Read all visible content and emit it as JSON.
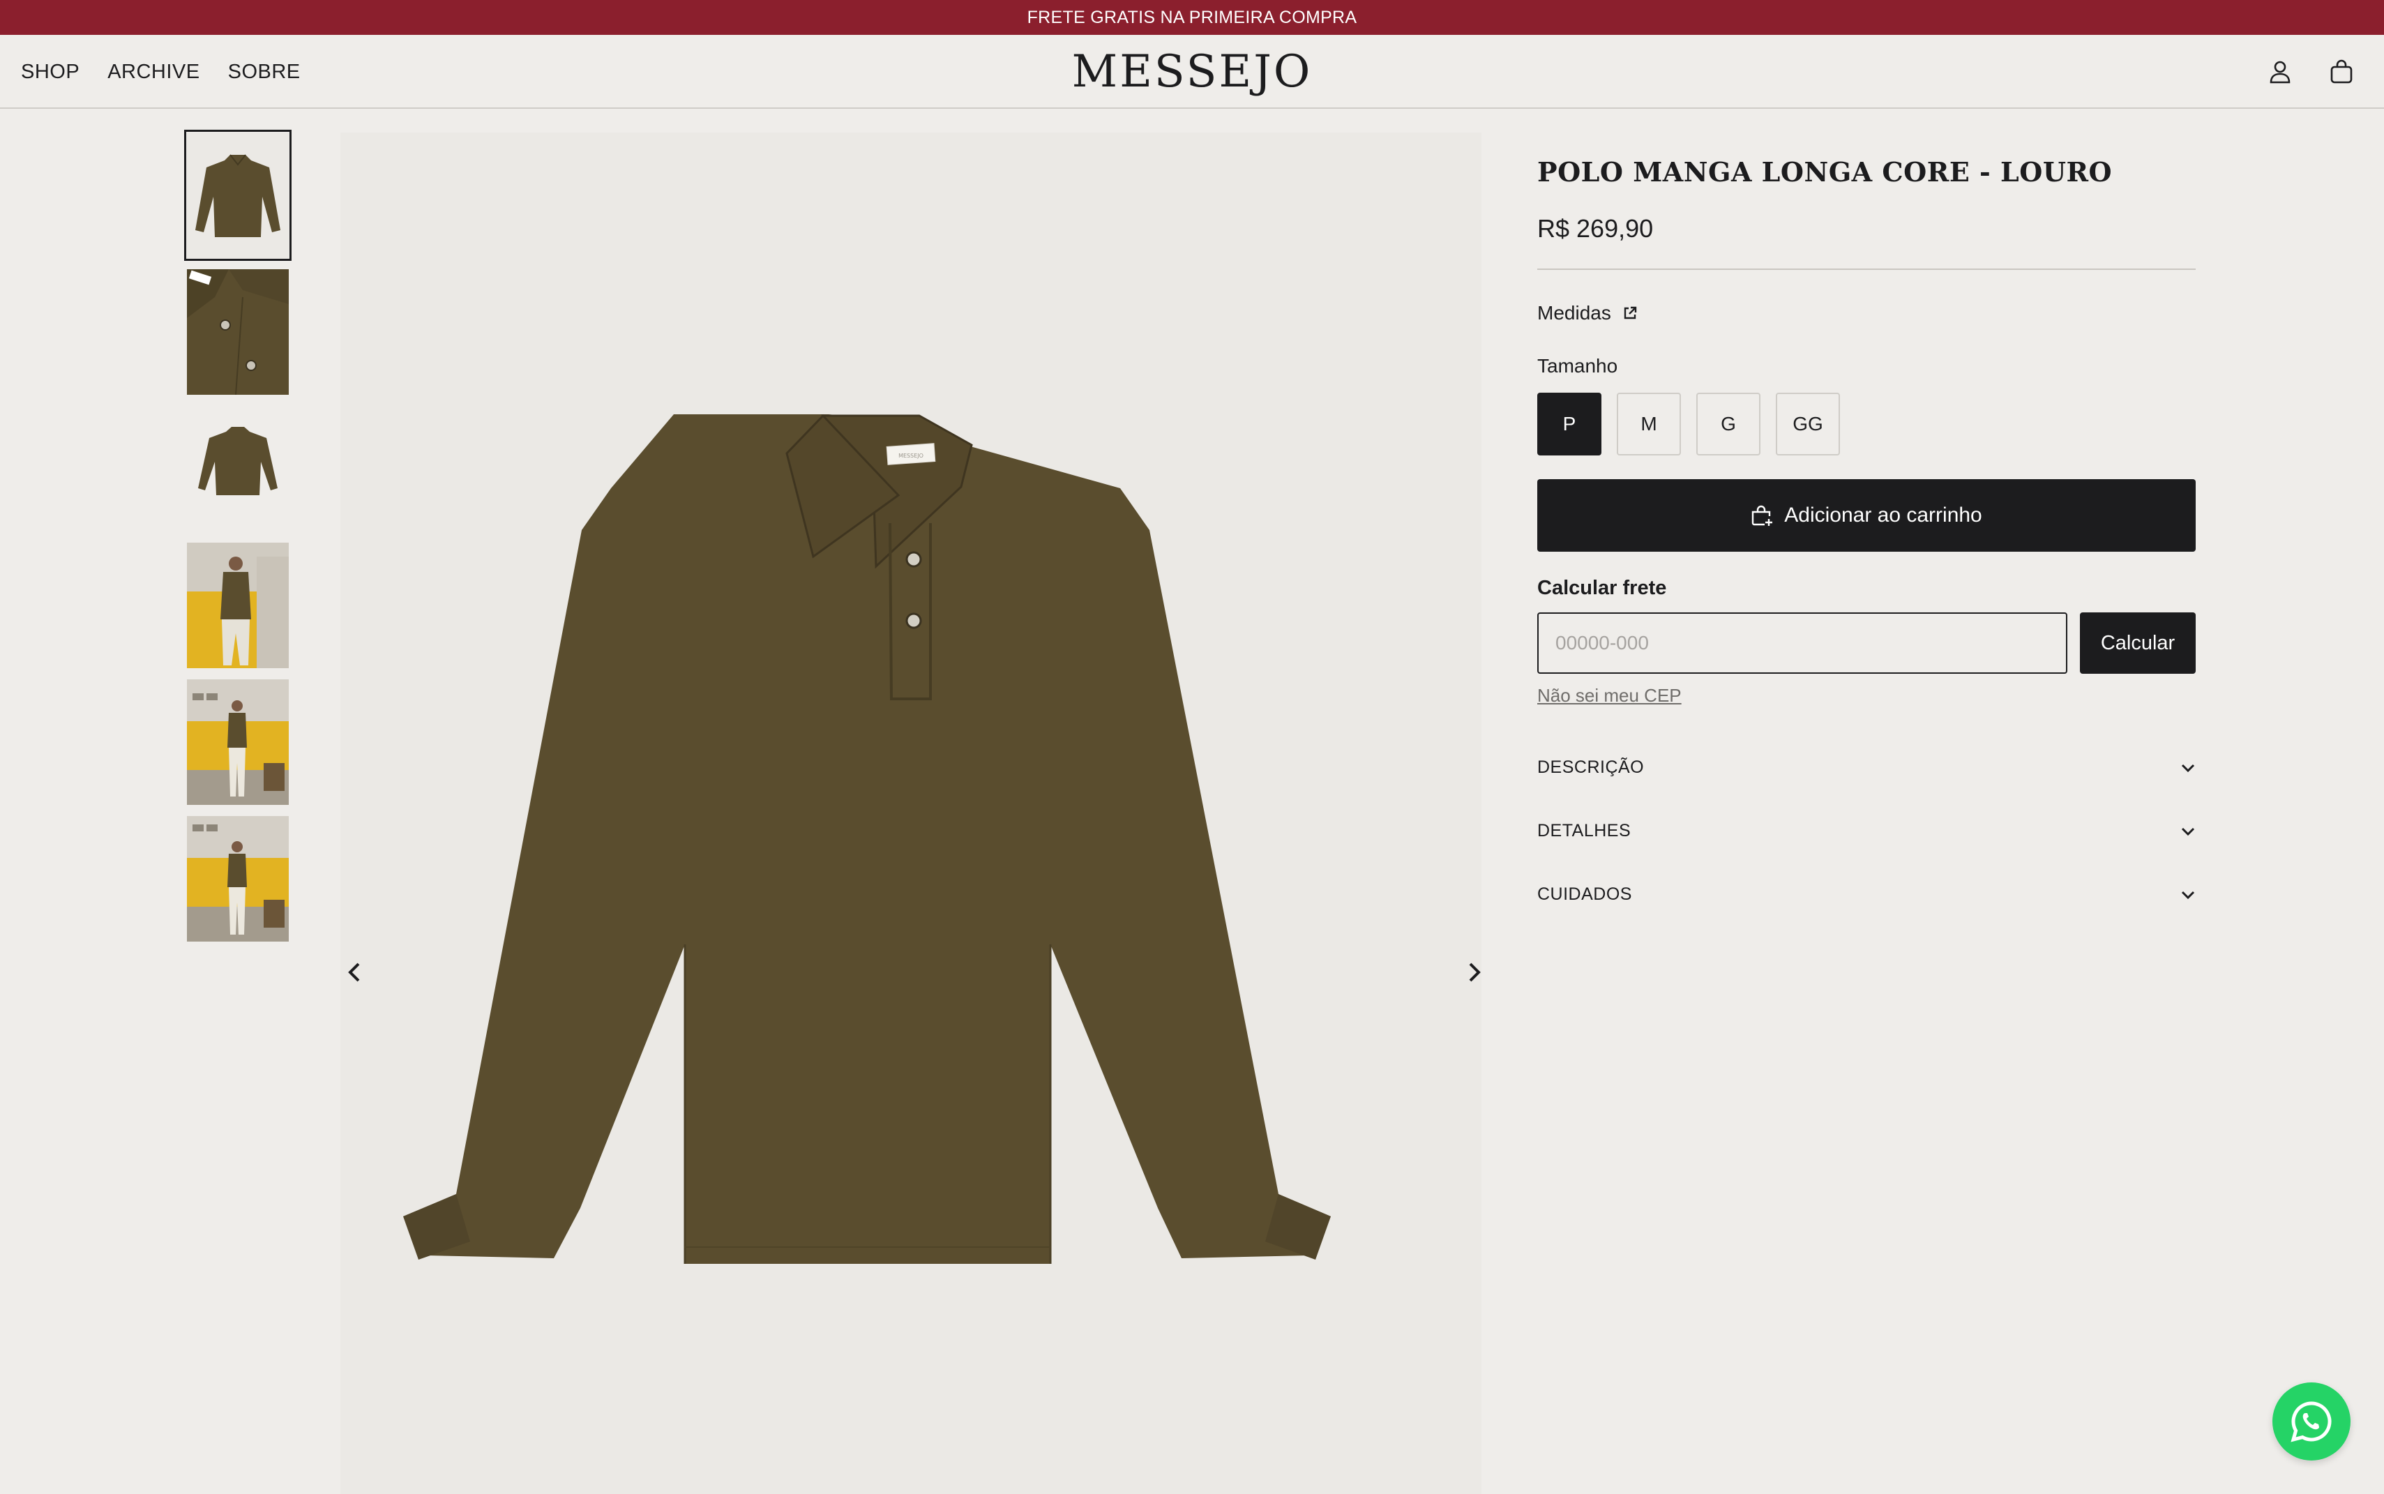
{
  "announcement": {
    "text": "FRETE GRATIS NA PRIMEIRA COMPRA"
  },
  "header": {
    "nav": [
      "SHOP",
      "ARCHIVE",
      "SOBRE"
    ],
    "logo": "MESSEJO",
    "icons": [
      "user-icon",
      "bag-icon"
    ]
  },
  "gallery": {
    "thumbnails": [
      "polo-front",
      "polo-collar-detail",
      "polo-front-small",
      "model-side",
      "model-standing",
      "model-front"
    ],
    "active_index": 0,
    "collar_label_text": "MESSEJO"
  },
  "product": {
    "title": "POLO MANGA LONGA CORE - LOURO",
    "price": "R$ 269,90",
    "medidas_label": "Medidas",
    "tamanho_label": "Tamanho",
    "sizes": [
      "P",
      "M",
      "G",
      "GG"
    ],
    "selected_size": "P",
    "add_to_cart_label": "Adicionar ao carrinho",
    "shipping": {
      "label": "Calcular frete",
      "placeholder": "00000-000",
      "button_label": "Calcular",
      "link_label": "Não sei meu CEP"
    },
    "accordions": [
      "DESCRIÇÃO",
      "DETALHES",
      "CUIDADOS"
    ]
  },
  "colors": {
    "announcement_bg": "#8b1f2d",
    "page_bg": "#efedea",
    "primary_dark": "#1c1c1e",
    "shirt": "#5a4d2e",
    "whatsapp": "#25d366"
  }
}
